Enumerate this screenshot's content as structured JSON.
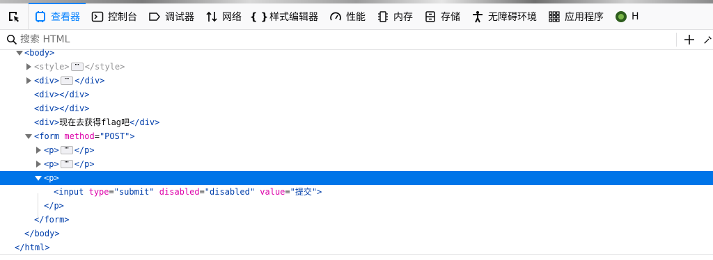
{
  "toolbar": {
    "tabs": [
      {
        "label": "查看器",
        "icon": "inspector-icon",
        "active": true
      },
      {
        "label": "控制台",
        "icon": "console-icon"
      },
      {
        "label": "调试器",
        "icon": "debugger-icon"
      },
      {
        "label": "网络",
        "icon": "network-icon"
      },
      {
        "label": "样式编辑器",
        "icon": "style-editor-icon"
      },
      {
        "label": "性能",
        "icon": "performance-icon"
      },
      {
        "label": "内存",
        "icon": "memory-icon"
      },
      {
        "label": "存储",
        "icon": "storage-icon"
      },
      {
        "label": "无障碍环境",
        "icon": "accessibility-icon"
      },
      {
        "label": "应用程序",
        "icon": "application-icon"
      },
      {
        "label": "H",
        "icon": "extension-icon"
      }
    ],
    "accent_color": "#0a84ff"
  },
  "search": {
    "placeholder": "搜索 HTML",
    "value": ""
  },
  "tree": {
    "selected_color": "#0074e8",
    "rows": [
      {
        "tag_open": "<body>"
      },
      {
        "tag_open": "<style>",
        "tag_close": "</style>"
      },
      {
        "tag_open": "<div>",
        "tag_close": "</div>"
      },
      {
        "tag_open": "<div>",
        "tag_close": "</div>"
      },
      {
        "tag_open": "<div>",
        "tag_close": "</div>"
      },
      {
        "tag_open": "<div>",
        "text": "现在去获得flag吧",
        "tag_close": "</div>"
      },
      {
        "tag_start": "<form",
        "attr_name": "method",
        "attr_value": "\"POST\"",
        "tag_end": ">"
      },
      {
        "tag_open": "<p>",
        "tag_close": "</p>"
      },
      {
        "tag_open": "<p>",
        "tag_close": "</p>"
      },
      {
        "tag_open": "<p>"
      },
      {
        "tag_start": "<input",
        "attr1_name": "type",
        "attr1_value": "\"submit\"",
        "attr2_name": "disabled",
        "attr2_value": "\"disabled\"",
        "attr3_name": "value",
        "attr3_value": "\"提交\"",
        "tag_end": ">"
      },
      {
        "tag_close": "</p>"
      },
      {
        "tag_close": "</form>"
      },
      {
        "tag_close": "</body>"
      },
      {
        "tag_close": "</html>"
      }
    ]
  },
  "misc": {
    "ellipsis": "⋯",
    "equals": "="
  }
}
